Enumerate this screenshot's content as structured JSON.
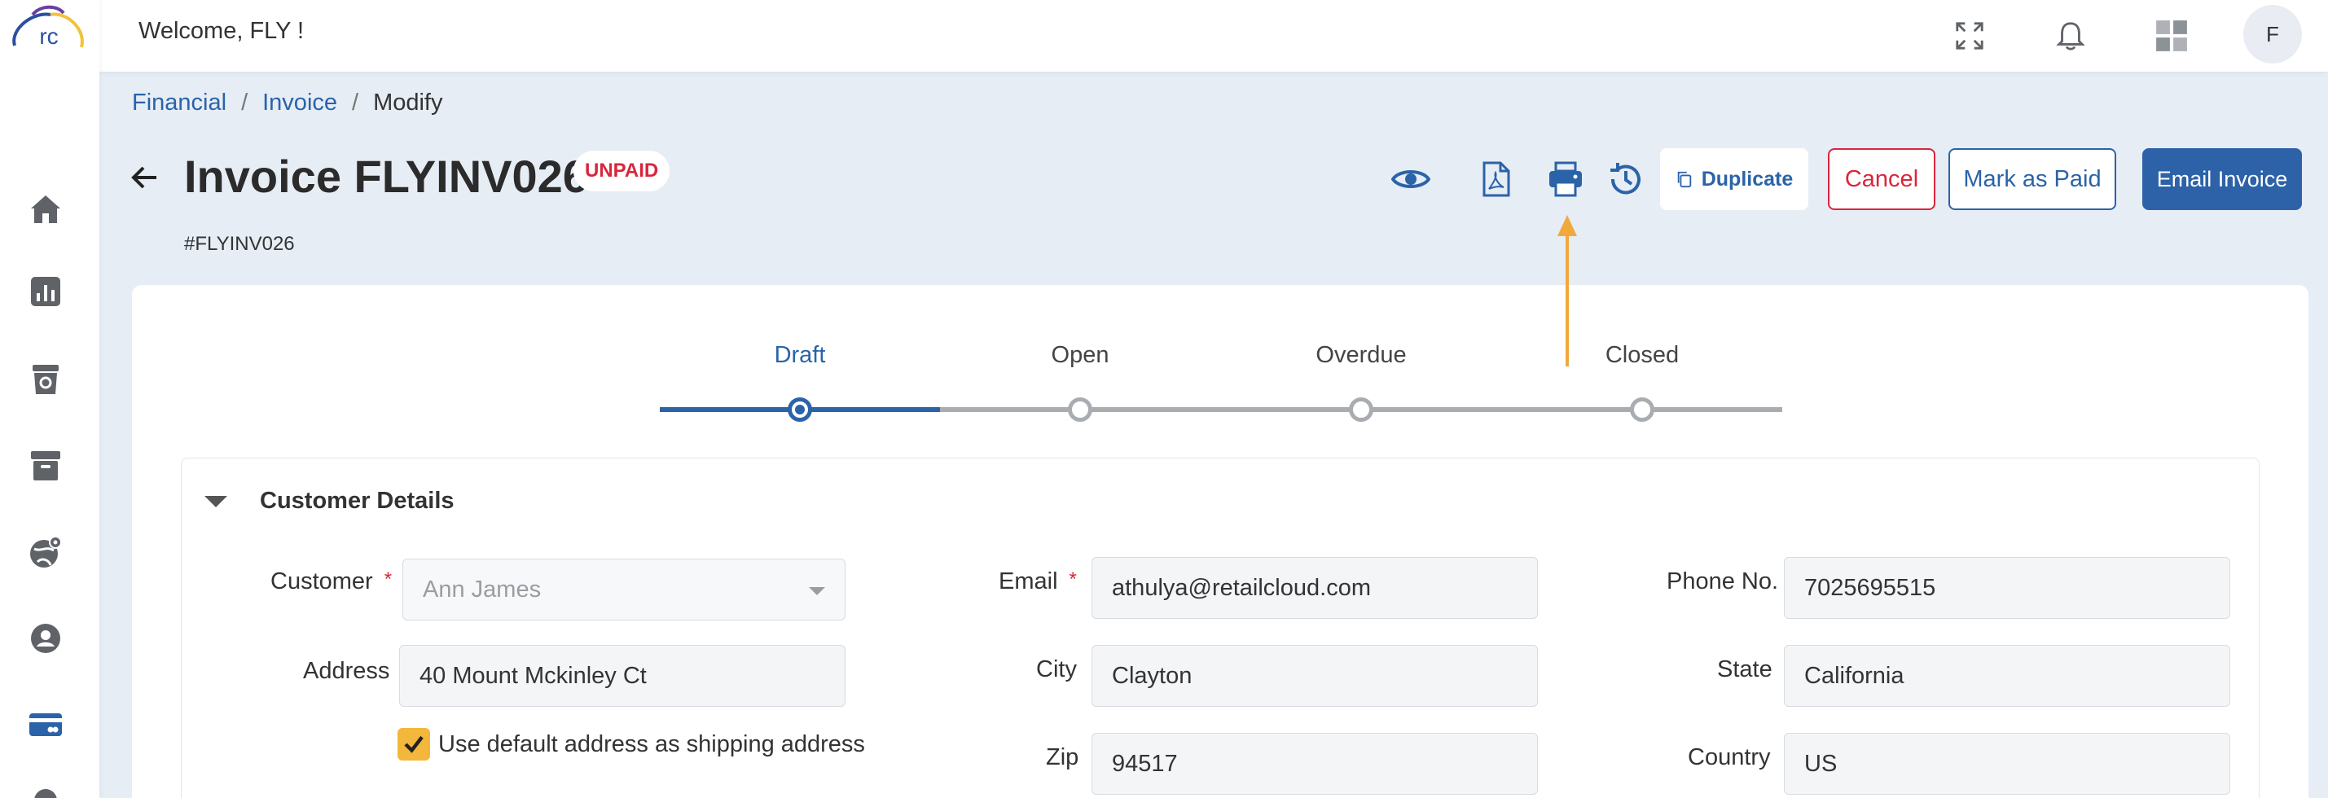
{
  "topbar": {
    "welcome": "Welcome, FLY !",
    "avatar_initial": "F"
  },
  "logo_text": "rc",
  "breadcrumb": {
    "items": [
      "Financial",
      "Invoice",
      "Modify"
    ],
    "separator": "/"
  },
  "header": {
    "title": "Invoice FLYINV026",
    "status": "UNPAID",
    "invoice_id": "#FLYINV026"
  },
  "actions": {
    "duplicate": "Duplicate",
    "cancel": "Cancel",
    "mark_paid": "Mark as Paid",
    "email": "Email Invoice"
  },
  "stepper": {
    "steps": [
      "Draft",
      "Open",
      "Overdue",
      "Closed"
    ],
    "active_index": 0
  },
  "customer_details": {
    "title": "Customer Details",
    "customer_label": "Customer",
    "customer_value": "Ann James",
    "email_label": "Email",
    "email_value": "athulya@retailcloud.com",
    "phone_label": "Phone No.",
    "phone_value": "7025695515",
    "address_label": "Address",
    "address_value": "40 Mount Mckinley Ct",
    "city_label": "City",
    "city_value": "Clayton",
    "state_label": "State",
    "state_value": "California",
    "zip_label": "Zip",
    "zip_value": "94517",
    "country_label": "Country",
    "country_value": "US",
    "default_address_label": "Use default address as shipping address",
    "required_mark": "*"
  },
  "colors": {
    "primary": "#2b63a8",
    "danger": "#d9263c",
    "annotation": "#f2a93b",
    "background": "#e6edf5"
  }
}
